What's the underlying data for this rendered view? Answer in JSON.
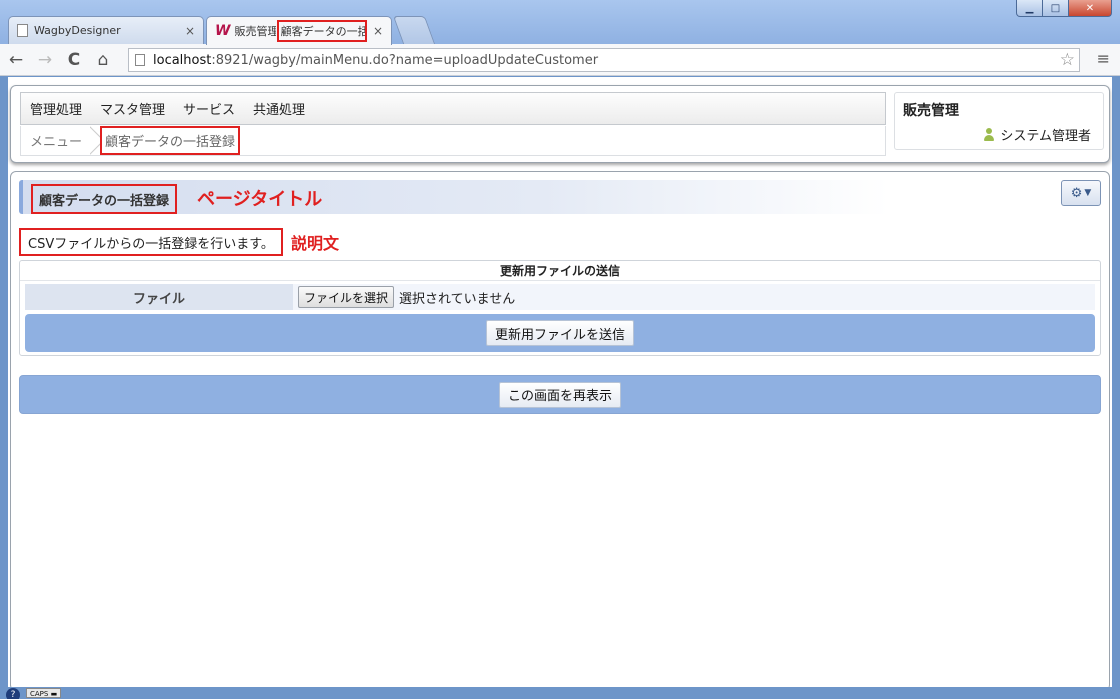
{
  "window": {
    "controls": {
      "minimize": "▁",
      "maximize": "□",
      "close": "✕"
    }
  },
  "tabs": [
    {
      "title": "WagbyDesigner",
      "close": "×"
    },
    {
      "title_app": "販売管理",
      "title_page": "顧客データの一括",
      "close": "×"
    }
  ],
  "toolbar": {
    "back": "←",
    "forward": "→",
    "reload": "C",
    "home": "⌂",
    "url_host": "localhost",
    "url_rest": ":8921/wagby/mainMenu.do?name=uploadUpdateCustomer",
    "star": "☆",
    "menu": "≡"
  },
  "menubar": {
    "items": [
      "管理処理",
      "マスタ管理",
      "サービス",
      "共通処理"
    ]
  },
  "breadcrumb": {
    "home": "メニュー",
    "current": "顧客データの一括登録"
  },
  "app": {
    "title": "販売管理",
    "user": "システム管理者"
  },
  "page": {
    "title": "顧客データの一括登録",
    "title_annotation": "ページタイトル",
    "description": "CSVファイルからの一括登録を行います。",
    "description_annotation": "説明文"
  },
  "upload": {
    "caption": "更新用ファイルの送信",
    "file_label": "ファイル",
    "choose_button": "ファイルを選択",
    "file_status": "選択されていません",
    "submit_button": "更新用ファイルを送信"
  },
  "reload_button": "この画面を再表示",
  "taskbar": {
    "help": "?",
    "caps": "CAPS",
    "dash": "▬"
  },
  "colors": {
    "accent": "#8fb0e1",
    "annotation": "#e02020"
  }
}
